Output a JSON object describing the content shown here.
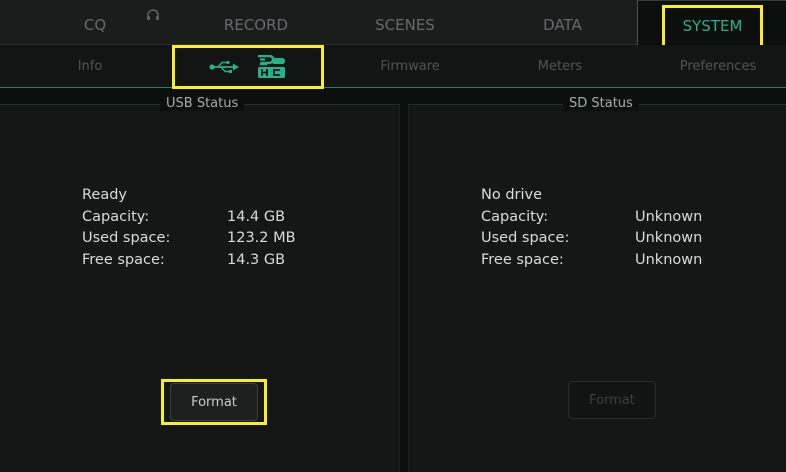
{
  "top_tabs": [
    {
      "label": "CQ"
    },
    {
      "label": "RECORD"
    },
    {
      "label": "SCENES"
    },
    {
      "label": "DATA"
    },
    {
      "label": "SYSTEM",
      "active": true
    }
  ],
  "sub_tabs": {
    "info": "Info",
    "firmware": "Firmware",
    "meters": "Meters",
    "preferences": "Preferences",
    "usb_sd_icons": [
      "usb-icon",
      "sdhc-icon"
    ]
  },
  "usb": {
    "title": "USB Status",
    "state": "Ready",
    "rows": [
      {
        "label": "Capacity:",
        "value": "14.4 GB"
      },
      {
        "label": "Used space:",
        "value": "123.2 MB"
      },
      {
        "label": "Free space:",
        "value": "14.3 GB"
      }
    ],
    "format_label": "Format"
  },
  "sd": {
    "title": "SD Status",
    "state": "No drive",
    "rows": [
      {
        "label": "Capacity:",
        "value": "Unknown"
      },
      {
        "label": "Used space:",
        "value": "Unknown"
      },
      {
        "label": "Free space:",
        "value": "Unknown"
      }
    ],
    "format_label": "Format"
  },
  "colors": {
    "accent": "#27b38a",
    "highlight": "#f6f024",
    "background": "#0d0e0e"
  }
}
